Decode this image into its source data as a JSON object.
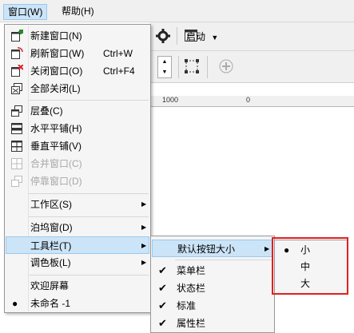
{
  "menubar": {
    "items": [
      {
        "label": "窗口(W)",
        "active": true
      },
      {
        "label": "帮助(H)",
        "active": false
      }
    ]
  },
  "toolbar": {
    "launch_label": "启动",
    "ruler_marks": [
      "1000",
      "0"
    ]
  },
  "window_menu": {
    "items": [
      {
        "label": "新建窗口(N)",
        "shortcut": "",
        "icon": "new-window-icon"
      },
      {
        "label": "刷新窗口(W)",
        "shortcut": "Ctrl+W",
        "icon": "refresh-window-icon"
      },
      {
        "label": "关闭窗口(O)",
        "shortcut": "Ctrl+F4",
        "icon": "close-window-icon"
      },
      {
        "label": "全部关闭(L)",
        "shortcut": "",
        "icon": "close-all-icon"
      },
      {
        "label": "层叠(C)",
        "shortcut": "",
        "icon": "cascade-icon"
      },
      {
        "label": "水平平铺(H)",
        "shortcut": "",
        "icon": "tile-horizontal-icon"
      },
      {
        "label": "垂直平铺(V)",
        "shortcut": "",
        "icon": "tile-vertical-icon"
      },
      {
        "label": "合并窗口(C)",
        "shortcut": "",
        "icon": "combine-window-icon",
        "disabled": true
      },
      {
        "label": "停靠窗口(D)",
        "shortcut": "",
        "icon": "dock-window-icon",
        "disabled": true
      },
      {
        "label": "工作区(S)",
        "submenu": true
      },
      {
        "label": "泊坞窗(D)",
        "submenu": true
      },
      {
        "label": "工具栏(T)",
        "submenu": true
      },
      {
        "label": "调色板(L)",
        "submenu": true
      },
      {
        "label": "欢迎屏幕"
      },
      {
        "label": "未命名 -1",
        "bullet": true
      }
    ]
  },
  "toolbar_submenu": {
    "items": [
      {
        "label": "默认按钮大小",
        "submenu": true
      },
      {
        "label": "菜单栏",
        "checked": true
      },
      {
        "label": "状态栏",
        "checked": true
      },
      {
        "label": "标准",
        "checked": true
      },
      {
        "label": "属性栏",
        "checked": true
      }
    ]
  },
  "button_size_submenu": {
    "items": [
      {
        "label": "小",
        "selected": true
      },
      {
        "label": "中",
        "selected": false
      },
      {
        "label": "大",
        "selected": false
      }
    ]
  },
  "colors": {
    "highlight": "#cce4f7",
    "annotation_border": "#e02020"
  }
}
